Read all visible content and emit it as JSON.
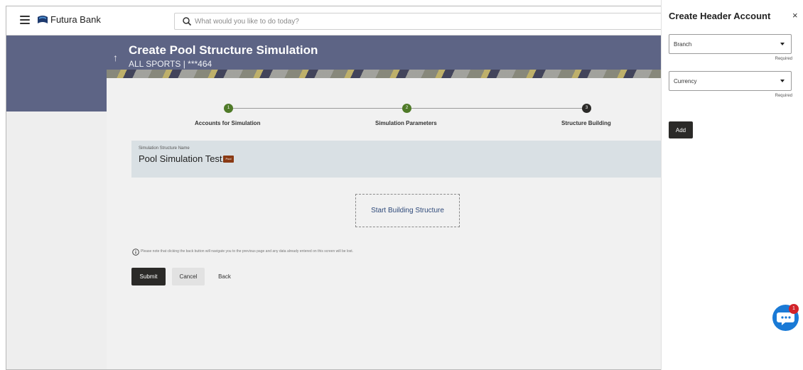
{
  "topbar": {
    "brand": "Futura Bank",
    "search_placeholder": "What would you like to do today?"
  },
  "header": {
    "title": "Create Pool Structure Simulation",
    "subtitle": "ALL SPORTS | ***464"
  },
  "stepper": {
    "steps": [
      {
        "number": "1",
        "label": "Accounts for Simulation",
        "color": "#4f7a28"
      },
      {
        "number": "2",
        "label": "Simulation Parameters",
        "color": "#4f7a28"
      },
      {
        "number": "3",
        "label": "Structure Building",
        "color": "#2b2a28"
      }
    ]
  },
  "structure": {
    "caption": "Simulation Structure Name",
    "name": "Pool Simulation Test1",
    "badge": "Pool"
  },
  "canvas": {
    "start_label": "Start Building Structure"
  },
  "note": {
    "text": "Please note that clicking the back button will navigate you to the previous page and any data already entered on this screen will be lost."
  },
  "actions": {
    "submit": "Submit",
    "cancel": "Cancel",
    "back": "Back"
  },
  "panel": {
    "title": "Create Header Account",
    "close": "×",
    "branch_label": "Branch",
    "branch_required": "Required",
    "currency_label": "Currency",
    "currency_required": "Required",
    "add": "Add"
  },
  "chat": {
    "badge": "1"
  },
  "colors": {
    "header_band": "#5d6485",
    "primary_button": "#2b2a28",
    "chat": "#1a7ad6",
    "badge": "#8a3a14"
  }
}
